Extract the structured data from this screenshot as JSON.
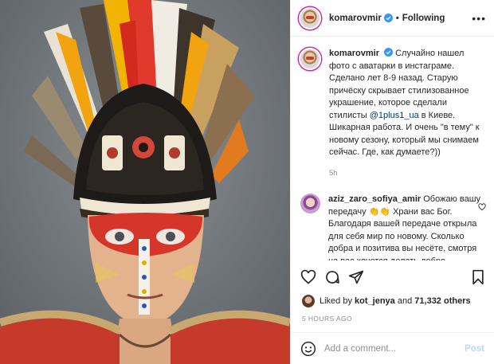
{
  "post": {
    "image_alt": "Portrait of a man wearing a feathered headdress and red face paint",
    "colors": {
      "accent": "#0095f6",
      "verified": "#3897f0",
      "link": "#00376b",
      "muted": "#8e8e8e"
    }
  },
  "header": {
    "username": "komarovmir",
    "separator": "•",
    "follow_label": "Following",
    "more_icon": "more-horizontal-icon"
  },
  "caption": {
    "username": "komarovmir",
    "text_before_mention": "Случайно нашел фото с аватарки в инстаграме. Сделано лет 8-9 назад. Старую причёску скрывает стилизованное украшение, которое сделали стилисты",
    "mention": "@1plus1_ua",
    "text_after_mention": "в Киеве. Шикарная работа. И очень \"в тему\" к новому сезону, который мы снимаем сейчас. Где, как думаете?))",
    "time": "5h"
  },
  "comment": {
    "username": "aziz_zaro_sofiya_amir",
    "text": "Обожаю вашу передачу 👏👏 Храни вас Бог. Благодаря вашей передаче открыла для себя мир по новому. Сколько добра и позитива вы несёте, смотря на вас,хочется делать добро."
  },
  "likes": {
    "prefix": "Liked by",
    "user": "kot_jenya",
    "and": "and",
    "count": "71,332 others"
  },
  "posted_ago": "5 HOURS AGO",
  "add_comment": {
    "placeholder": "Add a comment...",
    "post_label": "Post"
  }
}
